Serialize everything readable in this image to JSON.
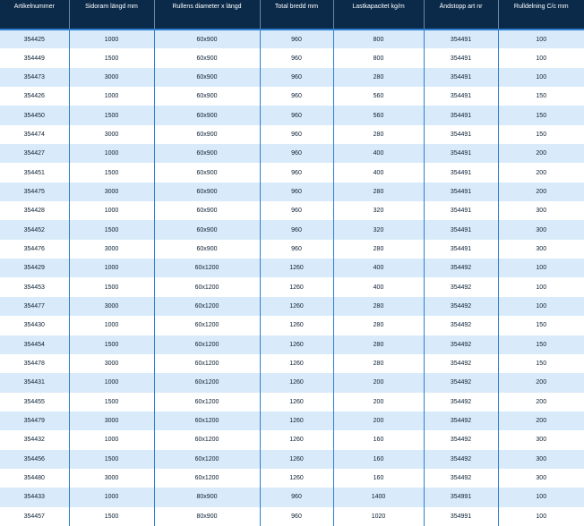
{
  "table": {
    "headers": [
      "Artikelnummer",
      "Sidoram längd mm",
      "Rullens diameter x längd",
      "Total bredd mm",
      "Lastkapacitet kg/m",
      "Ändstopp art nr",
      "Rulldelning C/c mm"
    ],
    "rows": [
      [
        "354425",
        "1000",
        "60x900",
        "960",
        "800",
        "354491",
        "100"
      ],
      [
        "354449",
        "1500",
        "60x900",
        "960",
        "800",
        "354491",
        "100"
      ],
      [
        "354473",
        "3000",
        "60x900",
        "960",
        "280",
        "354491",
        "100"
      ],
      [
        "354426",
        "1000",
        "60x900",
        "960",
        "560",
        "354491",
        "150"
      ],
      [
        "354450",
        "1500",
        "60x900",
        "960",
        "560",
        "354491",
        "150"
      ],
      [
        "354474",
        "3000",
        "60x900",
        "960",
        "280",
        "354491",
        "150"
      ],
      [
        "354427",
        "1000",
        "60x900",
        "960",
        "400",
        "354491",
        "200"
      ],
      [
        "354451",
        "1500",
        "60x900",
        "960",
        "400",
        "354491",
        "200"
      ],
      [
        "354475",
        "3000",
        "60x900",
        "960",
        "280",
        "354491",
        "200"
      ],
      [
        "354428",
        "1000",
        "60x900",
        "960",
        "320",
        "354491",
        "300"
      ],
      [
        "354452",
        "1500",
        "60x900",
        "960",
        "320",
        "354491",
        "300"
      ],
      [
        "354476",
        "3000",
        "60x900",
        "960",
        "280",
        "354491",
        "300"
      ],
      [
        "354429",
        "1000",
        "60x1200",
        "1260",
        "400",
        "354492",
        "100"
      ],
      [
        "354453",
        "1500",
        "60x1200",
        "1260",
        "400",
        "354492",
        "100"
      ],
      [
        "354477",
        "3000",
        "60x1200",
        "1260",
        "280",
        "354492",
        "100"
      ],
      [
        "354430",
        "1000",
        "60x1200",
        "1260",
        "280",
        "354492",
        "150"
      ],
      [
        "354454",
        "1500",
        "60x1200",
        "1260",
        "280",
        "354492",
        "150"
      ],
      [
        "354478",
        "3000",
        "60x1200",
        "1260",
        "280",
        "354492",
        "150"
      ],
      [
        "354431",
        "1000",
        "60x1200",
        "1260",
        "200",
        "354492",
        "200"
      ],
      [
        "354455",
        "1500",
        "60x1200",
        "1260",
        "200",
        "354492",
        "200"
      ],
      [
        "354479",
        "3000",
        "60x1200",
        "1260",
        "200",
        "354492",
        "200"
      ],
      [
        "354432",
        "1000",
        "60x1200",
        "1260",
        "160",
        "354492",
        "300"
      ],
      [
        "354456",
        "1500",
        "60x1200",
        "1260",
        "160",
        "354492",
        "300"
      ],
      [
        "354480",
        "3000",
        "60x1200",
        "1260",
        "160",
        "354492",
        "300"
      ],
      [
        "354433",
        "1000",
        "80x900",
        "960",
        "1400",
        "354991",
        "100"
      ],
      [
        "354457",
        "1500",
        "80x900",
        "960",
        "1020",
        "354991",
        "100"
      ]
    ]
  }
}
